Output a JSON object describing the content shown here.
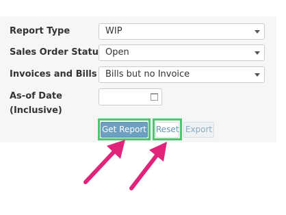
{
  "form": {
    "report_type": {
      "label": "Report Type",
      "value": "WIP"
    },
    "sales_order_status": {
      "label": "Sales Order Status",
      "value": "Open"
    },
    "invoices_and_bills": {
      "label": "Invoices and Bills",
      "value": "Bills but no Invoice"
    },
    "as_of_date": {
      "label_line1": "As-of Date",
      "label_line2": "(Inclusive)",
      "value": ""
    }
  },
  "buttons": {
    "get_report": "Get Report",
    "reset": "Reset",
    "export": "Export"
  },
  "annotations": {
    "highlight_color": "#46c96c",
    "arrow_color": "#e0247c",
    "highlighted_targets": [
      "get-report-button",
      "reset-button"
    ]
  }
}
